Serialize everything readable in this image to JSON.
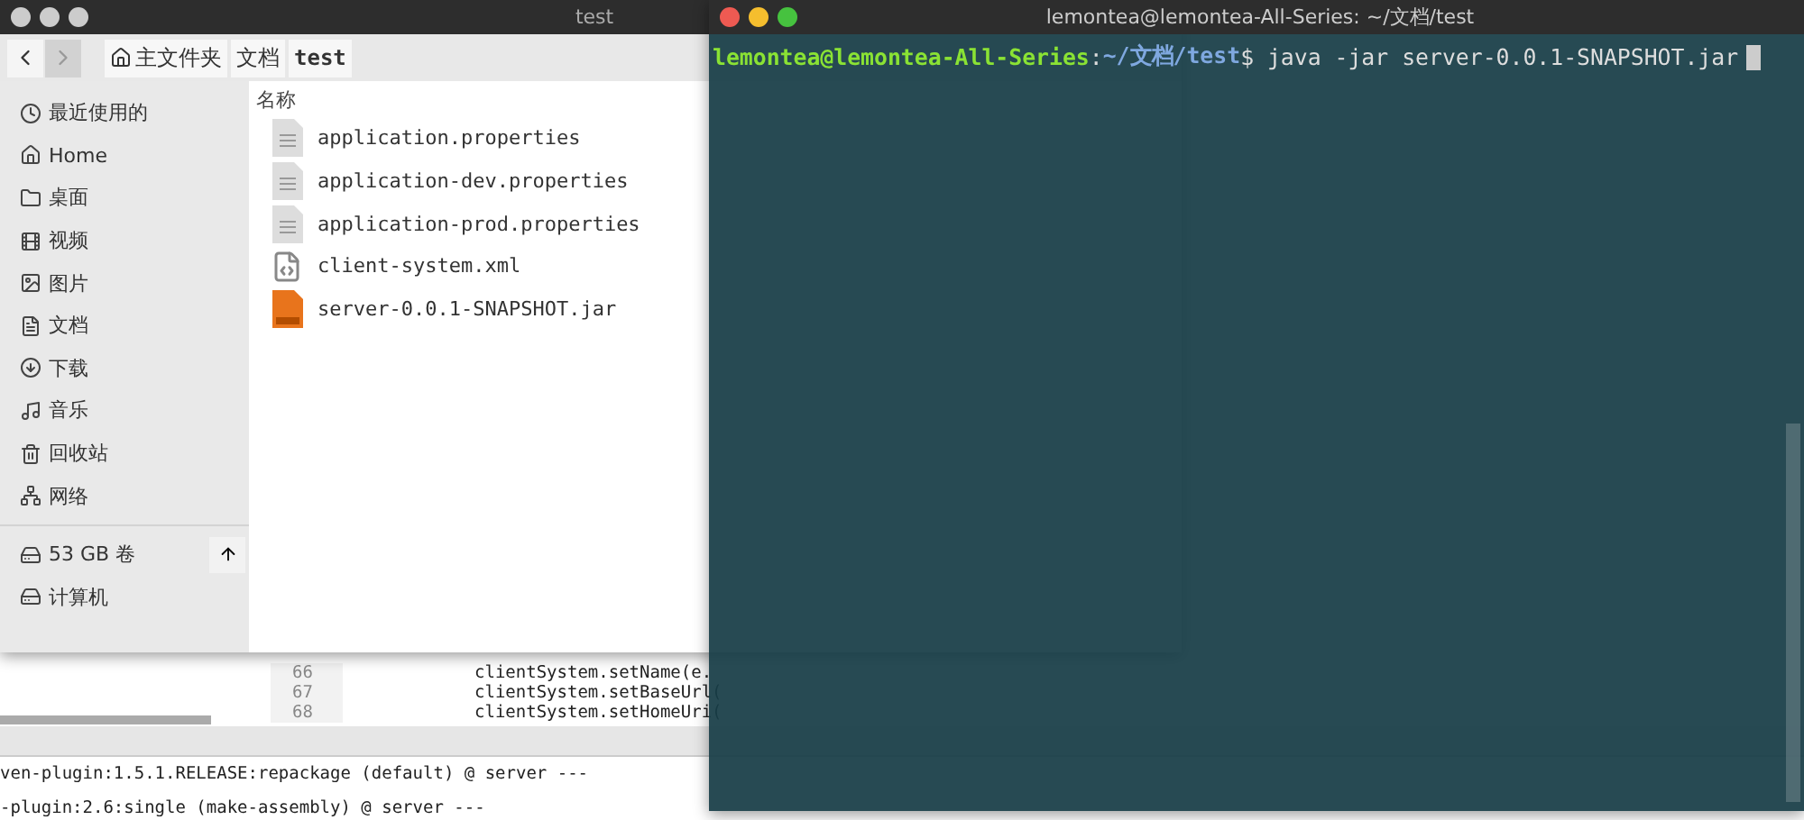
{
  "ide": {
    "code_lines": [
      {
        "number": "66",
        "code": "clientSystem.setName(e."
      },
      {
        "number": "67",
        "code": "clientSystem.setBaseUrl("
      },
      {
        "number": "68",
        "code": "clientSystem.setHomeUri("
      }
    ],
    "console": [
      "ven-plugin:1.5.1.RELEASE:repackage (default) @ server ---",
      "-plugin:2.6:single (make-assembly) @ server ---"
    ]
  },
  "file_manager": {
    "title": "test",
    "focused": false,
    "nav": [
      {
        "kind": "back",
        "disabled": false
      },
      {
        "kind": "forward",
        "disabled": true
      }
    ],
    "breadcrumbs": [
      {
        "label": "主文件夹",
        "kind": "home",
        "selected": false
      },
      {
        "label": "文档",
        "kind": "folder",
        "selected": false
      },
      {
        "label": "test",
        "kind": "folder",
        "selected": true
      }
    ],
    "places": [
      "最近使用的",
      "Home",
      "桌面",
      "视频",
      "图片",
      "文档",
      "下载",
      "音乐",
      "回收站",
      "网络"
    ],
    "devices": [
      {
        "label": "53 GB 卷",
        "eject": true
      },
      {
        "label": "计算机",
        "eject": false
      }
    ],
    "columns": [
      "名称"
    ],
    "files": [
      {
        "name": "application.properties",
        "kind": "text"
      },
      {
        "name": "application-dev.properties",
        "kind": "text"
      },
      {
        "name": "application-prod.properties",
        "kind": "text"
      },
      {
        "name": "client-system.xml",
        "kind": "markup"
      },
      {
        "name": "server-0.0.1-SNAPSHOT.jar",
        "kind": "archive"
      }
    ]
  },
  "terminal": {
    "title": "lemontea@lemontea-All-Series: ~/文档/test",
    "focused": true,
    "user": "lemontea@lemontea-All-Series",
    "separator": ":",
    "path": "~/文档/test",
    "sign": "$",
    "command": "java -jar server-0.0.1-SNAPSHOT.jar"
  }
}
